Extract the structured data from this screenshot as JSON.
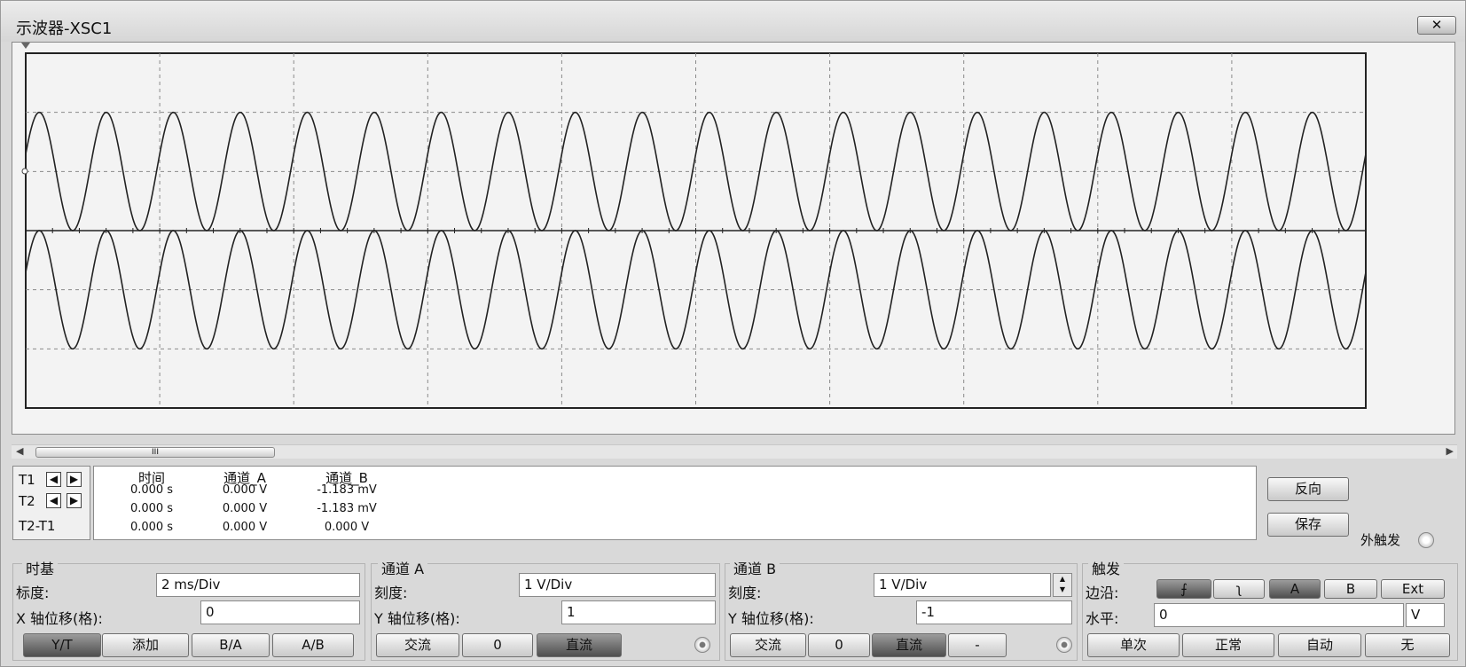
{
  "window": {
    "title": "示波器-XSC1",
    "close": "✕"
  },
  "scrollbar": {
    "left": "◀",
    "right": "▶",
    "thumb": "III"
  },
  "cursors": {
    "headers": [
      "时间",
      "通道_A",
      "通道_B"
    ],
    "rows": [
      {
        "label": "T1",
        "time": "0.000 s",
        "a": "0.000 V",
        "b": "-1.183 mV"
      },
      {
        "label": "T2",
        "time": "0.000 s",
        "a": "0.000 V",
        "b": "-1.183 mV"
      },
      {
        "label": "T2-T1",
        "time": "0.000 s",
        "a": "0.000 V",
        "b": "0.000 V"
      }
    ],
    "reverse": "反向",
    "save": "保存",
    "ext_trigger": "外触发"
  },
  "timebase": {
    "title": "时基",
    "scale_label": "标度:",
    "scale": "2 ms/Div",
    "xpos_label": "X 轴位移(格):",
    "xpos": "0",
    "buttons": [
      "Y/T",
      "添加",
      "B/A",
      "A/B"
    ]
  },
  "channel_a": {
    "title": "通道 A",
    "scale_label": "刻度:",
    "scale": "1  V/Div",
    "ypos_label": "Y 轴位移(格):",
    "ypos": "1",
    "buttons": [
      "交流",
      "0",
      "直流"
    ]
  },
  "channel_b": {
    "title": "通道 B",
    "scale_label": "刻度:",
    "scale": "1  V/Div",
    "ypos_label": "Y 轴位移(格):",
    "ypos": "-1",
    "buttons": [
      "交流",
      "0",
      "直流",
      "-"
    ]
  },
  "trigger": {
    "title": "触发",
    "edge_label": "边沿:",
    "edge_buttons": [
      "⨍",
      "ʅ",
      "A",
      "B",
      "Ext"
    ],
    "level_label": "水平:",
    "level": "0",
    "level_unit": "V",
    "mode_buttons": [
      "单次",
      "正常",
      "自动",
      "无"
    ]
  },
  "display": {
    "cycles_visible": 20,
    "amplitude_div": 1,
    "cha_offset_div": 1,
    "chb_offset_div": -1,
    "h_divisions": 10,
    "v_divisions": 6
  }
}
